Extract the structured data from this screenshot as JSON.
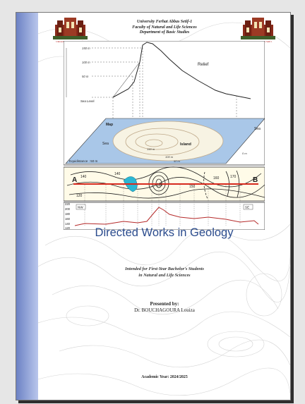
{
  "header": {
    "university": "University Ferhat Abbas Setif-1",
    "faculty": "Faculty of Natural and Life Sciences",
    "department": "Department of Basic Studies",
    "logo_caption": "Université Ferhat Abbas Sétif 1"
  },
  "relief_diagram": {
    "relief_label": "Relief",
    "elevation_labels": [
      "150 m",
      "100 m",
      "50 m"
    ],
    "sea_level_label": "Sea Level",
    "map_label": "Map",
    "sea_label": "Sea",
    "island_label": "Island",
    "peak_label": "150 m",
    "contour_100_label": "100 m",
    "contour_50_label": "50 m",
    "zero_label": "0 m",
    "equidistance_label": "Equidistance : 50 m"
  },
  "topo_profile": {
    "point_a": "A",
    "point_b": "B",
    "contour_labels": [
      "140",
      "140",
      "120",
      "150",
      "160",
      "170",
      "180"
    ],
    "y_ticks": [
      "220",
      "200",
      "180",
      "160",
      "140",
      "120"
    ],
    "left_direction": "NW",
    "right_direction": "SE"
  },
  "title": "Directed Works in Geology",
  "intended_for": [
    "Intended for First-Year Bachelor's Students",
    "in Natural and Life Sciences"
  ],
  "presented_by_label": "Presented by:",
  "author": "Dr. BOUCHAGOURA Louiza",
  "academic_year": "Academic Year: 2024/2025",
  "colors": {
    "title": "#2b4c8e",
    "spine": "#8096d3",
    "map_sea": "#a9c7e8",
    "profile_line": "#d62a1e"
  }
}
